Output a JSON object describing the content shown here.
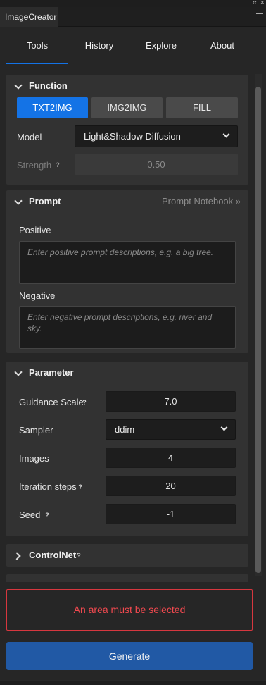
{
  "window": {
    "collapse_glyph": "‹‹",
    "close_glyph": "×",
    "title": "ImageCreator"
  },
  "tabs": [
    {
      "label": "Tools",
      "active": true
    },
    {
      "label": "History",
      "active": false
    },
    {
      "label": "Explore",
      "active": false
    },
    {
      "label": "About",
      "active": false
    }
  ],
  "function": {
    "title": "Function",
    "modes": [
      "TXT2IMG",
      "IMG2IMG",
      "FILL"
    ],
    "selected_mode": "TXT2IMG",
    "model_label": "Model",
    "model_value": "Light&Shadow Diffusion",
    "strength_label": "Strength",
    "strength_value": "0.50"
  },
  "prompt": {
    "title": "Prompt",
    "notebook_link": "Prompt Notebook »",
    "positive_label": "Positive",
    "positive_placeholder": "Enter positive prompt descriptions, e.g. a big tree.",
    "negative_label": "Negative",
    "negative_placeholder": "Enter negative prompt descriptions, e.g. river and sky."
  },
  "parameter": {
    "title": "Parameter",
    "guidance_label": "Guidance Scale",
    "guidance_value": "7.0",
    "sampler_label": "Sampler",
    "sampler_value": "ddim",
    "images_label": "Images",
    "images_value": "4",
    "steps_label": "Iteration steps",
    "steps_value": "20",
    "seed_label": "Seed",
    "seed_value": "-1"
  },
  "controlnet": {
    "title": "ControlNet"
  },
  "help_glyph": "?",
  "alert_text": "An area must be selected",
  "generate_label": "Generate",
  "colors": {
    "accent": "#1473e6",
    "generate": "#2159a5",
    "alert": "#f0494f",
    "panel": "#323232",
    "background": "#262626"
  }
}
